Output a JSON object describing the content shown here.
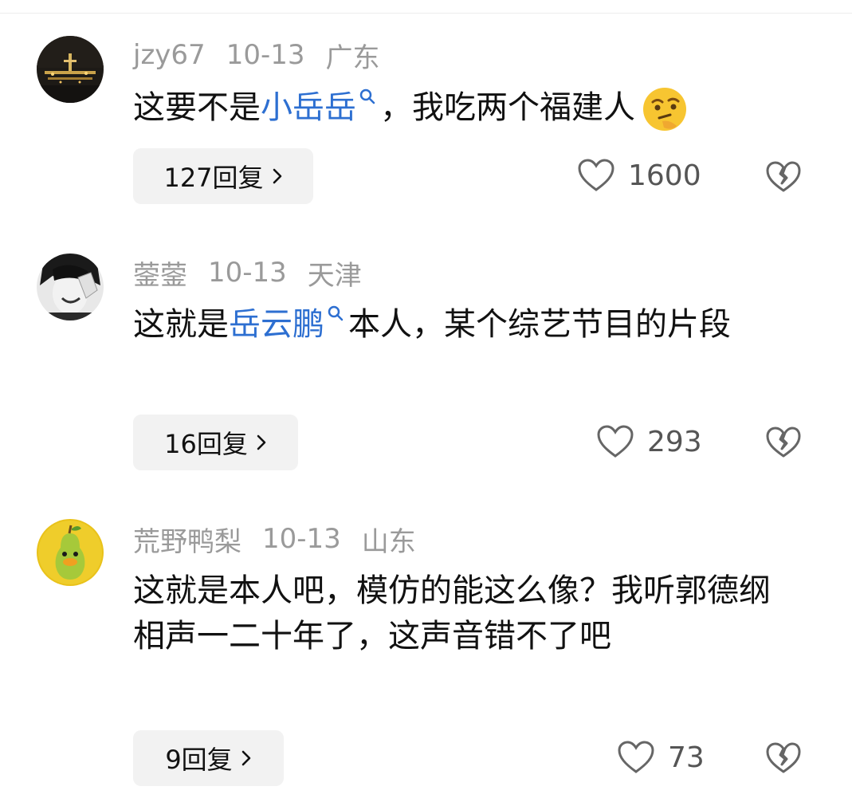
{
  "comments": [
    {
      "username": "jzy67",
      "date": "10-13",
      "location": "广东",
      "text_before": "这要不是",
      "keyword": "小岳岳",
      "text_after": "，我吃两个福建人",
      "replies_label": "127回复",
      "likes": "1600",
      "avatar_icon": "night-city-avatar",
      "emoji_icon": "thinking-face-emoji"
    },
    {
      "username": "蓥蓥",
      "date": "10-13",
      "location": "天津",
      "text_before": "这就是",
      "keyword": "岳云鹏",
      "text_after": "本人，某个综艺节目的片段",
      "replies_label": "16回复",
      "likes": "293",
      "avatar_icon": "laughing-person-avatar"
    },
    {
      "username": "荒野鸭梨",
      "date": "10-13",
      "location": "山东",
      "text": "这就是本人吧，模仿的能这么像？我听郭德纲相声一二十年了，这声音错不了吧",
      "replies_label": "9回复",
      "likes": "73",
      "avatar_icon": "pear-duck-avatar"
    }
  ],
  "colors": {
    "keyword": "#2d6fd1",
    "meta": "#9a9a9a",
    "reply_bg": "#f2f2f2"
  }
}
